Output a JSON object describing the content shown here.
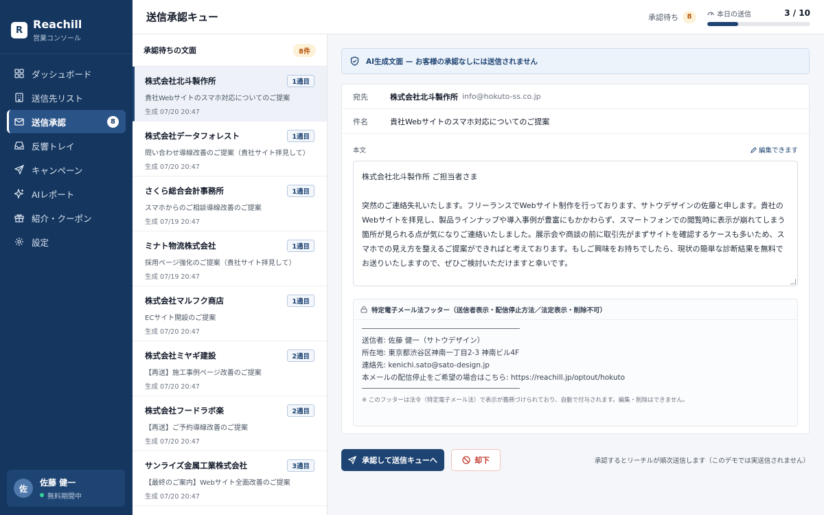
{
  "brand": {
    "logo_letter": "R",
    "name": "Reachill",
    "subtitle": "営業コンソール"
  },
  "sidebar": {
    "items": [
      {
        "label": "ダッシュボード",
        "icon": "dashboard-icon"
      },
      {
        "label": "送信先リスト",
        "icon": "building-icon"
      },
      {
        "label": "送信承認",
        "icon": "mail-icon",
        "badge": "8",
        "active": true
      },
      {
        "label": "反響トレイ",
        "icon": "inbox-icon"
      },
      {
        "label": "キャンペーン",
        "icon": "send-icon"
      },
      {
        "label": "AIレポート",
        "icon": "sparkle-icon"
      },
      {
        "label": "紹介・クーポン",
        "icon": "gift-icon"
      },
      {
        "label": "設定",
        "icon": "gear-icon"
      }
    ]
  },
  "user": {
    "avatar": "佐",
    "name": "佐藤 健一",
    "status": "無料期間中"
  },
  "header": {
    "title": "送信承認キュー",
    "pending_label": "承認待ち",
    "pending_count": "8",
    "sent_label": "本日の送信",
    "sent_count": "3 / 10",
    "sent_fraction": 0.3
  },
  "queue": {
    "title": "承認待ちの文面",
    "count": "8件",
    "items": [
      {
        "company": "株式会社北斗製作所",
        "tag": "1通目",
        "subject": "貴社Webサイトのスマホ対応についてのご提案",
        "date": "生成 07/20 20:47"
      },
      {
        "company": "株式会社データフォレスト",
        "tag": "1通目",
        "subject": "問い合わせ導線改善のご提案（貴社サイト拝見して）",
        "date": "生成 07/20 20:47"
      },
      {
        "company": "さくら総合会計事務所",
        "tag": "1通目",
        "subject": "スマホからのご相談導線改善のご提案",
        "date": "生成 07/19 20:47"
      },
      {
        "company": "ミナト物流株式会社",
        "tag": "1通目",
        "subject": "採用ページ強化のご提案（貴社サイト拝見して）",
        "date": "生成 07/19 20:47"
      },
      {
        "company": "株式会社マルフク商店",
        "tag": "1通目",
        "subject": "ECサイト開設のご提案",
        "date": "生成 07/20 20:47"
      },
      {
        "company": "株式会社ミヤギ建設",
        "tag": "2通目",
        "subject": "【再送】施工事例ページ改善のご提案",
        "date": "生成 07/20 20:47"
      },
      {
        "company": "株式会社フードラボ楽",
        "tag": "2通目",
        "subject": "【再送】ご予約導線改善のご提案",
        "date": "生成 07/20 20:47"
      },
      {
        "company": "サンライズ金属工業株式会社",
        "tag": "3通目",
        "subject": "【最終のご案内】Webサイト全面改善のご提案",
        "date": "生成 07/20 20:47"
      }
    ]
  },
  "detail": {
    "banner": "AI生成文面 — お客様の承認なしには送信されません",
    "to_label": "宛先",
    "to_name": "株式会社北斗製作所",
    "to_email": "info@hokuto-ss.co.jp",
    "subject_label": "件名",
    "subject": "貴社Webサイトのスマホ対応についてのご提案",
    "body_label": "本文",
    "editable_label": "編集できます",
    "body_greeting": "株式会社北斗製作所 ご担当者さま",
    "body_text": "突然のご連絡失礼いたします。フリーランスでWebサイト制作を行っております、サトウデザインの佐藤と申します。貴社のWebサイトを拝見し、製品ラインナップや導入事例が豊富にもかかわらず、スマートフォンでの閲覧時に表示が崩れてしまう箇所が見られる点が気になりご連絡いたしました。展示会や商談の前に取引先がまずサイトを確認するケースも多いため、スマホでの見え方を整えるご提案ができればと考えております。もしご興味をお持ちでしたら、現状の簡単な診断結果を無料でお送りいたしますので、ぜひご検討いただけますと幸いです。",
    "footer_title": "特定電子メール法フッター（送信者表示・配信停止方法／法定表示・削除不可）",
    "footer_lines": [
      "送信者: 佐藤 健一（サトウデザイン）",
      "所在地: 東京都渋谷区神南一丁目2-3 神南ビル4F",
      "連絡先: kenichi.sato@sato-design.jp",
      "本メールの配信停止をご希望の場合はこちら: https://reachill.jp/optout/hokuto"
    ],
    "footer_note": "※ このフッターは法令（特定電子メール法）で表示が義務づけられており、自動で付与されます。編集・削除はできません。"
  },
  "actions": {
    "approve_label": "承認して送信キューへ",
    "reject_label": "却下",
    "note": "承認するとリーチルが順次送信します（このデモでは実送信されません）"
  }
}
